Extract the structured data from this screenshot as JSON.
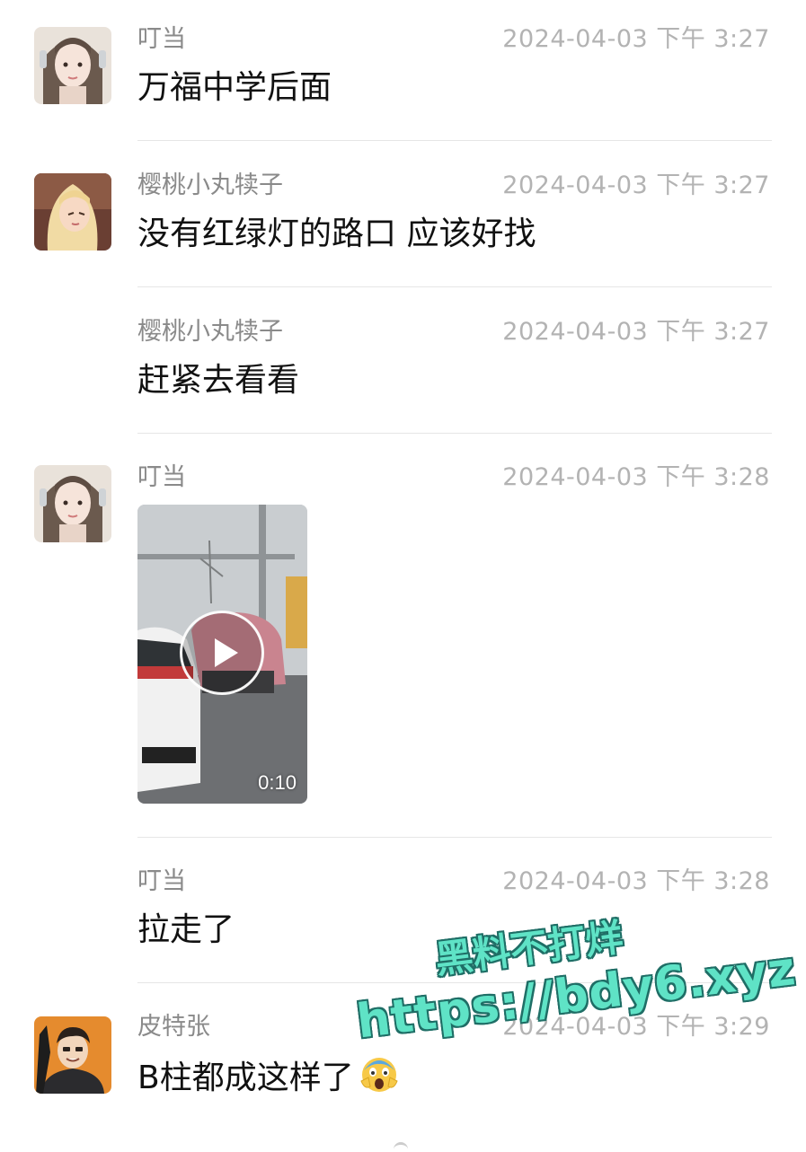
{
  "messages": [
    {
      "name": "叮当",
      "time": "2024-04-03 下午 3:27",
      "text": "万福中学后面",
      "avatar": "avatar-girl-headphones"
    },
    {
      "name": "樱桃小丸犊子",
      "time": "2024-04-03 下午 3:27",
      "text": "没有红绿灯的路口 应该好找",
      "avatar": "avatar-cartoon-blonde"
    },
    {
      "name": "樱桃小丸犊子",
      "time": "2024-04-03 下午 3:27",
      "text": "赶紧去看看"
    },
    {
      "name": "叮当",
      "time": "2024-04-03 下午 3:28",
      "avatar": "avatar-girl-headphones",
      "video": {
        "duration": "0:10",
        "icon": "play-icon"
      }
    },
    {
      "name": "叮当",
      "time": "2024-04-03 下午 3:28",
      "text": "拉走了"
    },
    {
      "name": "皮特张",
      "time": "2024-04-03 下午 3:29",
      "text": "B柱都成这样了",
      "emoji": "screaming-face-emoji",
      "avatar": "avatar-cartoon-man"
    }
  ],
  "watermark": {
    "line1": "黑料不打烊",
    "line2": "https://bdy6.xyz"
  },
  "colors": {
    "name": "#8a8a8a",
    "time": "#b3b3b3",
    "text": "#111111",
    "divider": "#e6e6e6",
    "watermark": "#5fe3c6"
  }
}
